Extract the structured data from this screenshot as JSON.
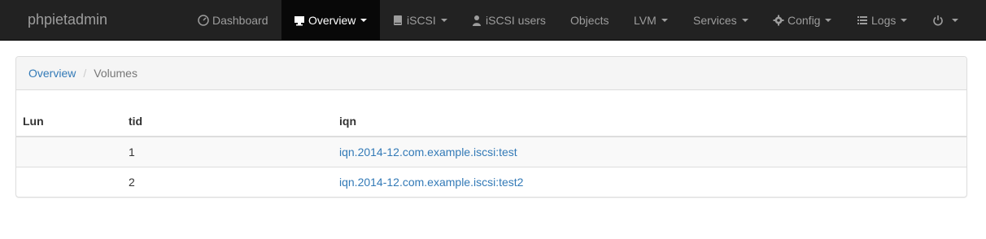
{
  "brand": "phpietadmin",
  "nav": {
    "dashboard": "Dashboard",
    "overview": "Overview",
    "iscsi": "iSCSI",
    "iscsi_users": "iSCSI users",
    "objects": "Objects",
    "lvm": "LVM",
    "services": "Services",
    "config": "Config",
    "logs": "Logs"
  },
  "breadcrumb": {
    "root": "Overview",
    "separator": "/",
    "current": "Volumes"
  },
  "table": {
    "headers": [
      "Lun",
      "tid",
      "iqn"
    ],
    "rows": [
      {
        "lun": "",
        "tid": "1",
        "iqn": "iqn.2014-12.com.example.iscsi:test"
      },
      {
        "lun": "",
        "tid": "2",
        "iqn": "iqn.2014-12.com.example.iscsi:test2"
      }
    ]
  },
  "colors": {
    "navbar_bg": "#222222",
    "nav_text": "#9d9d9d",
    "active_bg": "#080808",
    "link": "#337ab7"
  }
}
